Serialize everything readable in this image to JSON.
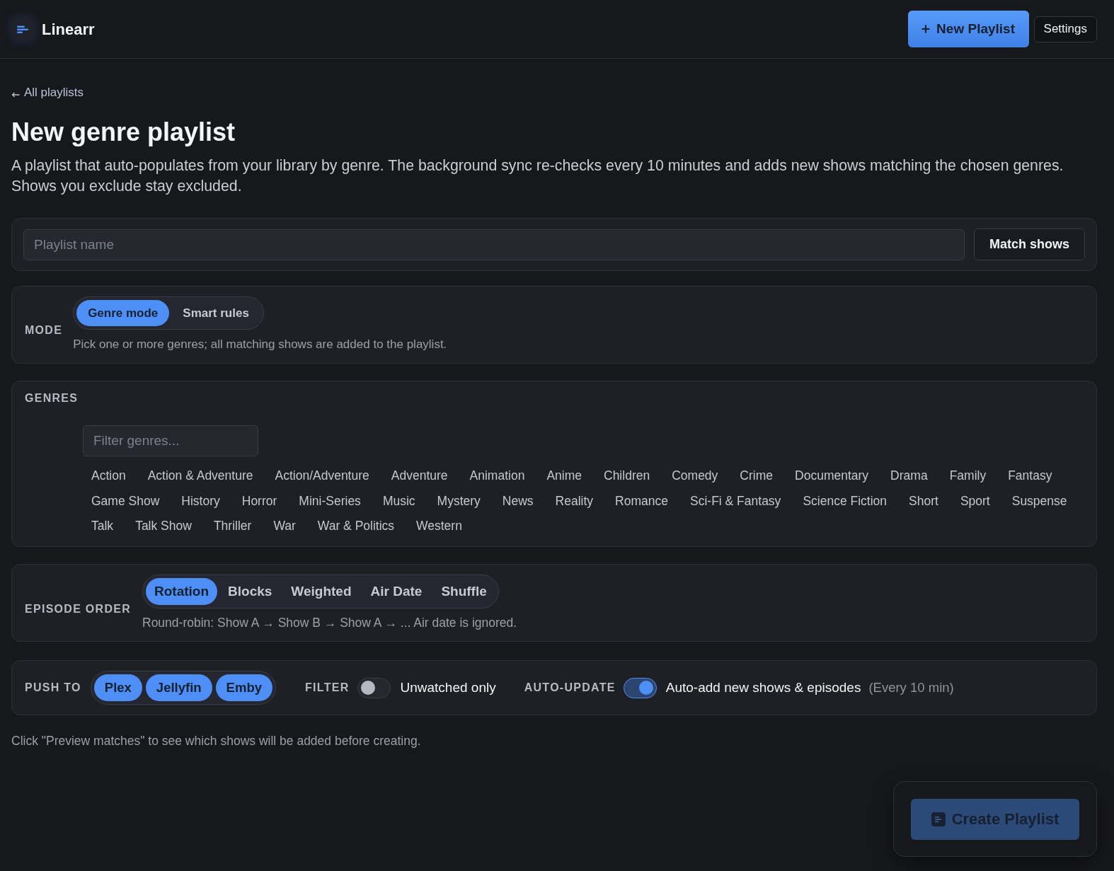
{
  "header": {
    "title": "Linearr",
    "new_playlist_button": "New Playlist",
    "settings_button": "Settings"
  },
  "back_link": "All playlists",
  "page": {
    "title": "New genre playlist",
    "description": "A playlist that auto-populates from your library by genre. The background sync re-checks every 10 minutes and adds new shows matching the chosen genres. Shows you exclude stay excluded."
  },
  "name_card": {
    "placeholder": "Playlist name",
    "button": "Match shows"
  },
  "mode": {
    "label": "MODE",
    "options": [
      {
        "label": "Genre mode",
        "selected": true
      },
      {
        "label": "Smart rules",
        "selected": false
      }
    ],
    "hint": "Pick one or more genres; all matching shows are added to the playlist."
  },
  "genres": {
    "label": "GENRES",
    "filter_placeholder": "Filter genres...",
    "items": [
      {
        "label": "Action",
        "selected": false
      },
      {
        "label": "Action & Adventure",
        "selected": false
      },
      {
        "label": "Action/Adventure",
        "selected": false
      },
      {
        "label": "Adventure",
        "selected": false
      },
      {
        "label": "Animation",
        "selected": false
      },
      {
        "label": "Anime",
        "selected": false
      },
      {
        "label": "Children",
        "selected": false
      },
      {
        "label": "Comedy",
        "selected": false
      },
      {
        "label": "Crime",
        "selected": false
      },
      {
        "label": "Documentary",
        "selected": false
      },
      {
        "label": "Drama",
        "selected": false
      },
      {
        "label": "Family",
        "selected": false
      },
      {
        "label": "Fantasy",
        "selected": false
      },
      {
        "label": "Game Show",
        "selected": false
      },
      {
        "label": "History",
        "selected": false
      },
      {
        "label": "Horror",
        "selected": false
      },
      {
        "label": "Mini-Series",
        "selected": false
      },
      {
        "label": "Music",
        "selected": false
      },
      {
        "label": "Mystery",
        "selected": false
      },
      {
        "label": "News",
        "selected": false
      },
      {
        "label": "Reality",
        "selected": false
      },
      {
        "label": "Romance",
        "selected": false
      },
      {
        "label": "Sci-Fi & Fantasy",
        "selected": false
      },
      {
        "label": "Science Fiction",
        "selected": false
      },
      {
        "label": "Short",
        "selected": false
      },
      {
        "label": "Sport",
        "selected": false
      },
      {
        "label": "Suspense",
        "selected": false
      },
      {
        "label": "Talk",
        "selected": false
      },
      {
        "label": "Talk Show",
        "selected": false
      },
      {
        "label": "Thriller",
        "selected": false
      },
      {
        "label": "War",
        "selected": false
      },
      {
        "label": "War & Politics",
        "selected": false
      },
      {
        "label": "Western",
        "selected": false
      }
    ]
  },
  "episode_order": {
    "label": "EPISODE ORDER",
    "options": [
      {
        "label": "Rotation",
        "selected": true
      },
      {
        "label": "Blocks",
        "selected": false
      },
      {
        "label": "Weighted",
        "selected": false
      },
      {
        "label": "Air Date",
        "selected": false
      },
      {
        "label": "Shuffle",
        "selected": false
      }
    ],
    "hint": "Round-robin: Show A → Show B → Show A → ... Air date is ignored."
  },
  "output": {
    "push_label": "PUSH TO",
    "targets": [
      {
        "label": "Plex",
        "selected": true
      },
      {
        "label": "Jellyfin",
        "selected": true
      },
      {
        "label": "Emby",
        "selected": true
      }
    ],
    "filter": {
      "label": "FILTER",
      "on": false,
      "text": "Unwatched only"
    },
    "auto_update": {
      "label": "AUTO-UPDATE",
      "on": true,
      "text": "Auto-add new shows & episodes",
      "note": "(Every 10 min)"
    }
  },
  "footer_note": "Click \"Preview matches\" to see which shows will be added before creating.",
  "create_button": {
    "label": "Create Playlist",
    "disabled": true
  }
}
